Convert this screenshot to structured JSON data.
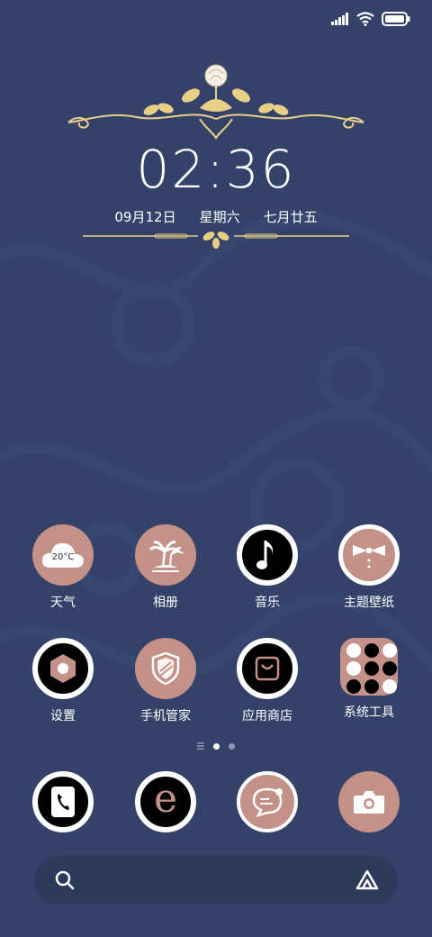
{
  "clock": {
    "time": "02:36"
  },
  "date": {
    "day": "09月12日",
    "weekday": "星期六",
    "lunar": "七月廿五"
  },
  "weather_widget": {
    "temp": "20°C"
  },
  "apps_row1": [
    {
      "label": "天气",
      "icon": "weather-cloud-icon"
    },
    {
      "label": "相册",
      "icon": "palm-island-icon"
    },
    {
      "label": "音乐",
      "icon": "music-note-icon"
    },
    {
      "label": "主题壁纸",
      "icon": "bowtie-icon"
    }
  ],
  "apps_row2": [
    {
      "label": "设置",
      "icon": "gear-hex-icon"
    },
    {
      "label": "手机管家",
      "icon": "shield-icon"
    },
    {
      "label": "应用商店",
      "icon": "store-bag-icon"
    },
    {
      "label": "系统工具",
      "icon": "folder-icon"
    }
  ],
  "dock": [
    {
      "icon": "phone-icon"
    },
    {
      "icon": "browser-e-icon"
    },
    {
      "icon": "message-bubble-icon"
    },
    {
      "icon": "camera-icon"
    }
  ],
  "page_indicator": {
    "count": 2,
    "active": 0
  },
  "colors": {
    "background": "#34426a",
    "accent_pink": "#c49188",
    "gold": "#e8cf88"
  }
}
